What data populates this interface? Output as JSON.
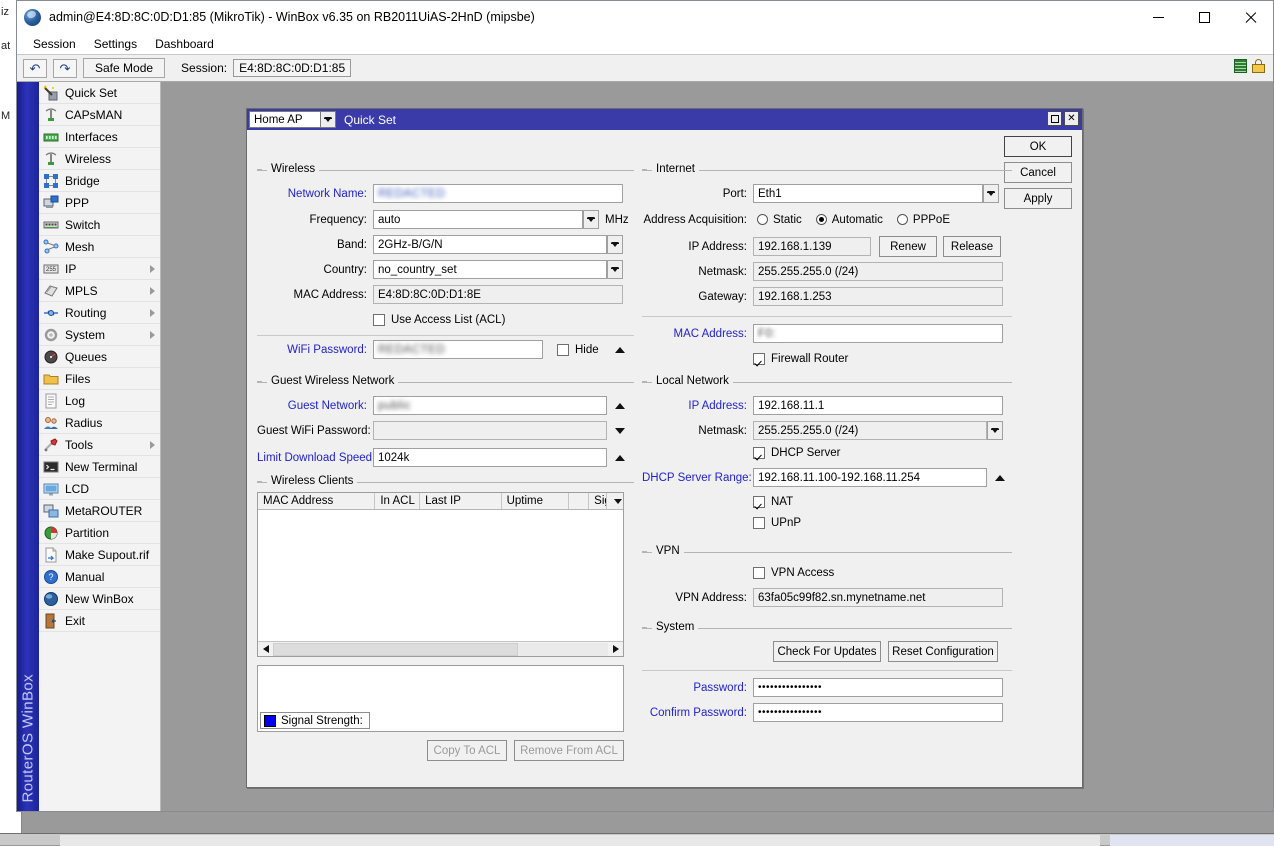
{
  "window": {
    "title": "admin@E4:8D:8C:0D:D1:85 (MikroTik) - WinBox v6.35 on RB2011UiAS-2HnD (mipsbe)",
    "app_icon": "winbox-globe-icon",
    "controls": {
      "minimize": "minimize-icon",
      "maximize": "maximize-icon",
      "close": "close-icon"
    }
  },
  "menubar": {
    "items": [
      "Session",
      "Settings",
      "Dashboard"
    ]
  },
  "toolbar": {
    "undo_icon": "undo-icon",
    "redo_icon": "redo-icon",
    "safe_mode_label": "Safe Mode",
    "session_label": "Session:",
    "session_value": "E4:8D:8C:0D:D1:85",
    "status_icons": [
      "signal-bars-icon",
      "lock-icon"
    ]
  },
  "side_strip": {
    "text": "RouterOS WinBox"
  },
  "sidebar": {
    "items": [
      {
        "label": "Quick Set",
        "icon": "quick-set-icon",
        "submenu": false
      },
      {
        "label": "CAPsMAN",
        "icon": "capsman-icon",
        "submenu": false
      },
      {
        "label": "Interfaces",
        "icon": "interfaces-icon",
        "submenu": false
      },
      {
        "label": "Wireless",
        "icon": "wireless-icon",
        "submenu": false
      },
      {
        "label": "Bridge",
        "icon": "bridge-icon",
        "submenu": false
      },
      {
        "label": "PPP",
        "icon": "ppp-icon",
        "submenu": false
      },
      {
        "label": "Switch",
        "icon": "switch-icon",
        "submenu": false
      },
      {
        "label": "Mesh",
        "icon": "mesh-icon",
        "submenu": false
      },
      {
        "label": "IP",
        "icon": "ip-icon",
        "submenu": true
      },
      {
        "label": "MPLS",
        "icon": "mpls-icon",
        "submenu": true
      },
      {
        "label": "Routing",
        "icon": "routing-icon",
        "submenu": true
      },
      {
        "label": "System",
        "icon": "system-gear-icon",
        "submenu": true
      },
      {
        "label": "Queues",
        "icon": "queues-icon",
        "submenu": false
      },
      {
        "label": "Files",
        "icon": "files-folder-icon",
        "submenu": false
      },
      {
        "label": "Log",
        "icon": "log-icon",
        "submenu": false
      },
      {
        "label": "Radius",
        "icon": "radius-users-icon",
        "submenu": false
      },
      {
        "label": "Tools",
        "icon": "tools-icon",
        "submenu": true
      },
      {
        "label": "New Terminal",
        "icon": "terminal-icon",
        "submenu": false
      },
      {
        "label": "LCD",
        "icon": "lcd-monitor-icon",
        "submenu": false
      },
      {
        "label": "MetaROUTER",
        "icon": "metarouter-icon",
        "submenu": false
      },
      {
        "label": "Partition",
        "icon": "partition-pie-icon",
        "submenu": false
      },
      {
        "label": "Make Supout.rif",
        "icon": "supout-file-icon",
        "submenu": false
      },
      {
        "label": "Manual",
        "icon": "manual-help-icon",
        "submenu": false
      },
      {
        "label": "New WinBox",
        "icon": "new-winbox-icon",
        "submenu": false
      },
      {
        "label": "Exit",
        "icon": "exit-door-icon",
        "submenu": false
      }
    ]
  },
  "dialog": {
    "mode_select": "Home AP",
    "title": "Quick Set",
    "controls": {
      "maximize": "maximize-icon",
      "close": "close-icon"
    },
    "buttons": {
      "ok": "OK",
      "cancel": "Cancel",
      "apply": "Apply"
    },
    "wireless": {
      "legend": "Wireless",
      "network_name_label": "Network Name:",
      "network_name_value": "REDACTED",
      "frequency_label": "Frequency:",
      "frequency_value": "auto",
      "frequency_unit": "MHz",
      "band_label": "Band:",
      "band_value": "2GHz-B/G/N",
      "country_label": "Country:",
      "country_value": "no_country_set",
      "mac_label": "MAC Address:",
      "mac_value": "E4:8D:8C:0D:D1:8E",
      "acl_label": "Use Access List (ACL)",
      "acl_checked": false,
      "wifi_password_label": "WiFi Password:",
      "wifi_password_value": "REDACTED",
      "hide_label": "Hide",
      "hide_checked": false
    },
    "guest": {
      "legend": "Guest Wireless Network",
      "guest_network_label": "Guest Network:",
      "guest_network_value": "public",
      "guest_password_label": "Guest WiFi Password:",
      "guest_password_value": "",
      "limit_label": "Limit Download Speed:",
      "limit_value": "1024k"
    },
    "clients": {
      "legend": "Wireless Clients",
      "columns": [
        "MAC Address",
        "In ACL",
        "Last IP",
        "Uptime",
        "",
        "Sig"
      ],
      "rows": [],
      "copy_to_acl": "Copy To ACL",
      "remove_from_acl": "Remove From ACL",
      "legend_swatch_color": "#0000ee",
      "signal_strength_label": "Signal Strength:"
    },
    "internet": {
      "legend": "Internet",
      "port_label": "Port:",
      "port_value": "Eth1",
      "acquisition_label": "Address Acquisition:",
      "acquisition_options": [
        "Static",
        "Automatic",
        "PPPoE"
      ],
      "acquisition_selected": "Automatic",
      "ip_label": "IP Address:",
      "ip_value": "192.168.1.139",
      "renew_label": "Renew",
      "release_label": "Release",
      "netmask_label": "Netmask:",
      "netmask_value": "255.255.255.0 (/24)",
      "gateway_label": "Gateway:",
      "gateway_value": "192.168.1.253",
      "mac_label": "MAC Address:",
      "mac_value": "F0:",
      "firewall_label": "Firewall Router",
      "firewall_checked": true
    },
    "local": {
      "legend": "Local Network",
      "ip_label": "IP Address:",
      "ip_value": "192.168.11.1",
      "netmask_label": "Netmask:",
      "netmask_value": "255.255.255.0 (/24)",
      "dhcp_label": "DHCP Server",
      "dhcp_checked": true,
      "dhcp_range_label": "DHCP Server Range:",
      "dhcp_range_value": "192.168.11.100-192.168.11.254",
      "nat_label": "NAT",
      "nat_checked": true,
      "upnp_label": "UPnP",
      "upnp_checked": false
    },
    "vpn": {
      "legend": "VPN",
      "access_label": "VPN Access",
      "access_checked": false,
      "address_label": "VPN Address:",
      "address_value": "63fa05c99f82.sn.mynetname.net"
    },
    "system": {
      "legend": "System",
      "check_updates_label": "Check For Updates",
      "reset_config_label": "Reset Configuration",
      "password_label": "Password:",
      "password_value": "••••••••••••••••",
      "confirm_password_label": "Confirm Password:",
      "confirm_password_value": "••••••••••••••••"
    }
  },
  "background": {
    "fragments": [
      "iz",
      "at",
      "M"
    ]
  }
}
